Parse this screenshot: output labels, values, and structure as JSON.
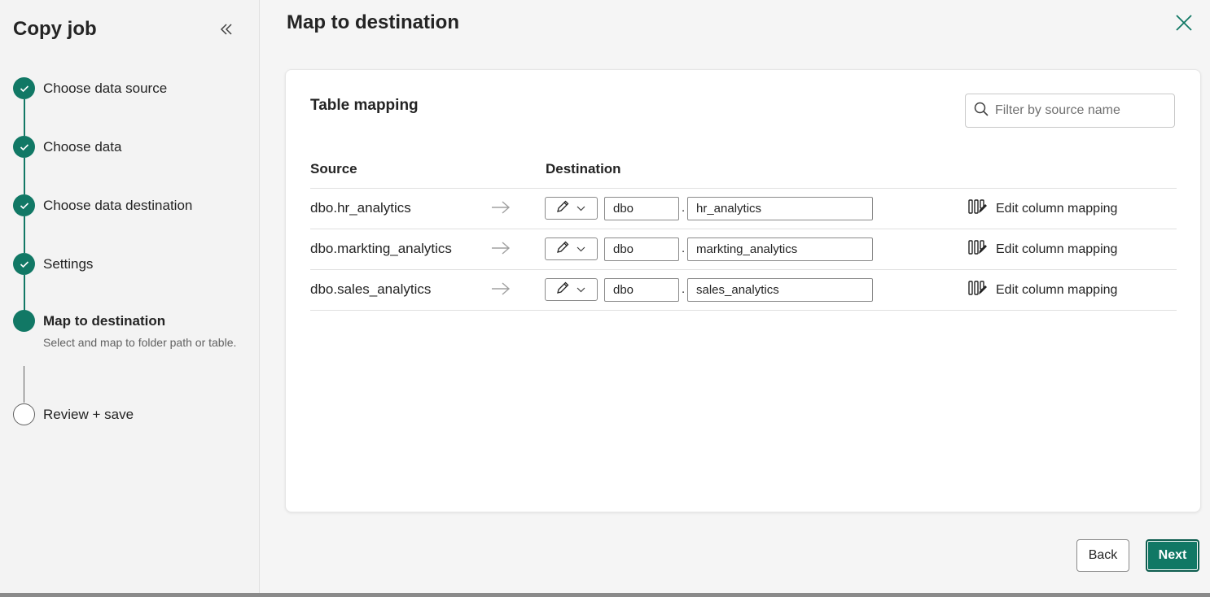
{
  "sidebar": {
    "title": "Copy job",
    "steps": [
      {
        "label": "Choose data source",
        "status": "complete"
      },
      {
        "label": "Choose data",
        "status": "complete"
      },
      {
        "label": "Choose data destination",
        "status": "complete"
      },
      {
        "label": "Settings",
        "status": "complete"
      },
      {
        "label": "Map to destination",
        "status": "active",
        "sub": "Select and map to folder path or table."
      },
      {
        "label": "Review + save",
        "status": "pending"
      }
    ]
  },
  "main": {
    "title": "Map to destination",
    "card": {
      "title": "Table mapping",
      "filter_placeholder": "Filter by source name",
      "columns": {
        "source": "Source",
        "destination": "Destination"
      },
      "rows": [
        {
          "source": "dbo.hr_analytics",
          "schema": "dbo",
          "dot": ".",
          "table": "hr_analytics",
          "edit": "Edit column mapping"
        },
        {
          "source": "dbo.markting_analytics",
          "schema": "dbo",
          "dot": ".",
          "table": "markting_analytics",
          "edit": "Edit column mapping"
        },
        {
          "source": "dbo.sales_analytics",
          "schema": "dbo",
          "dot": ".",
          "table": "sales_analytics",
          "edit": "Edit column mapping"
        }
      ]
    }
  },
  "footer": {
    "back": "Back",
    "next": "Next"
  },
  "colors": {
    "accent": "#117865"
  }
}
